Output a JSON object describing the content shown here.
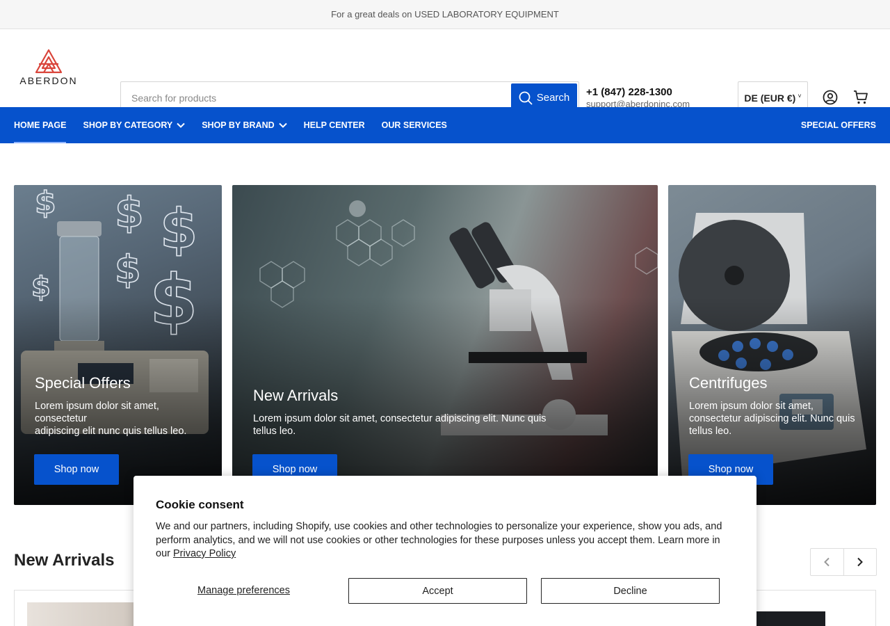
{
  "announcement": "For a great deals on USED LABORATORY EQUIPMENT",
  "logo_text": "ABERDON",
  "search": {
    "placeholder": "Search for products",
    "button_label": "Search"
  },
  "contact": {
    "phone": "+1 (847) 228-1300",
    "email": "support@aberdoninc.com"
  },
  "currency": {
    "selected": "DE (EUR €)"
  },
  "nav": {
    "items": [
      {
        "label": "HOME PAGE"
      },
      {
        "label": "SHOP BY CATEGORY"
      },
      {
        "label": "SHOP BY BRAND"
      },
      {
        "label": "HELP CENTER"
      },
      {
        "label": "OUR SERVICES"
      }
    ],
    "right_item": "SPECIAL OFFERS"
  },
  "banners": [
    {
      "title": "Special Offers",
      "text": "Lorem ipsum dolor sit amet, consectetur\nadipiscing elit nunc quis tellus leo.",
      "button": "Shop now"
    },
    {
      "title": "New Arrivals",
      "text": "Lorem ipsum dolor sit amet, consectetur adipiscing elit. Nunc quis tellus leo.",
      "button": "Shop now"
    },
    {
      "title": "Centrifuges",
      "text": "Lorem ipsum dolor sit amet, consectetur adipiscing elit. Nunc quis tellus leo.",
      "button": "Shop now"
    }
  ],
  "section": {
    "title": "New Arrivals"
  },
  "cookie": {
    "title": "Cookie consent",
    "text": "We and our partners, including Shopify, use cookies and other technologies to personalize your experience, show you ads, and perform analytics, and we will not use cookies or other technologies for these purposes unless you accept them. Learn more in our ",
    "privacy_link": "Privacy Policy",
    "manage": "Manage preferences",
    "accept": "Accept",
    "decline": "Decline"
  },
  "colors": {
    "brand_blue": "#0652cc",
    "logo_red": "#d9443a"
  }
}
